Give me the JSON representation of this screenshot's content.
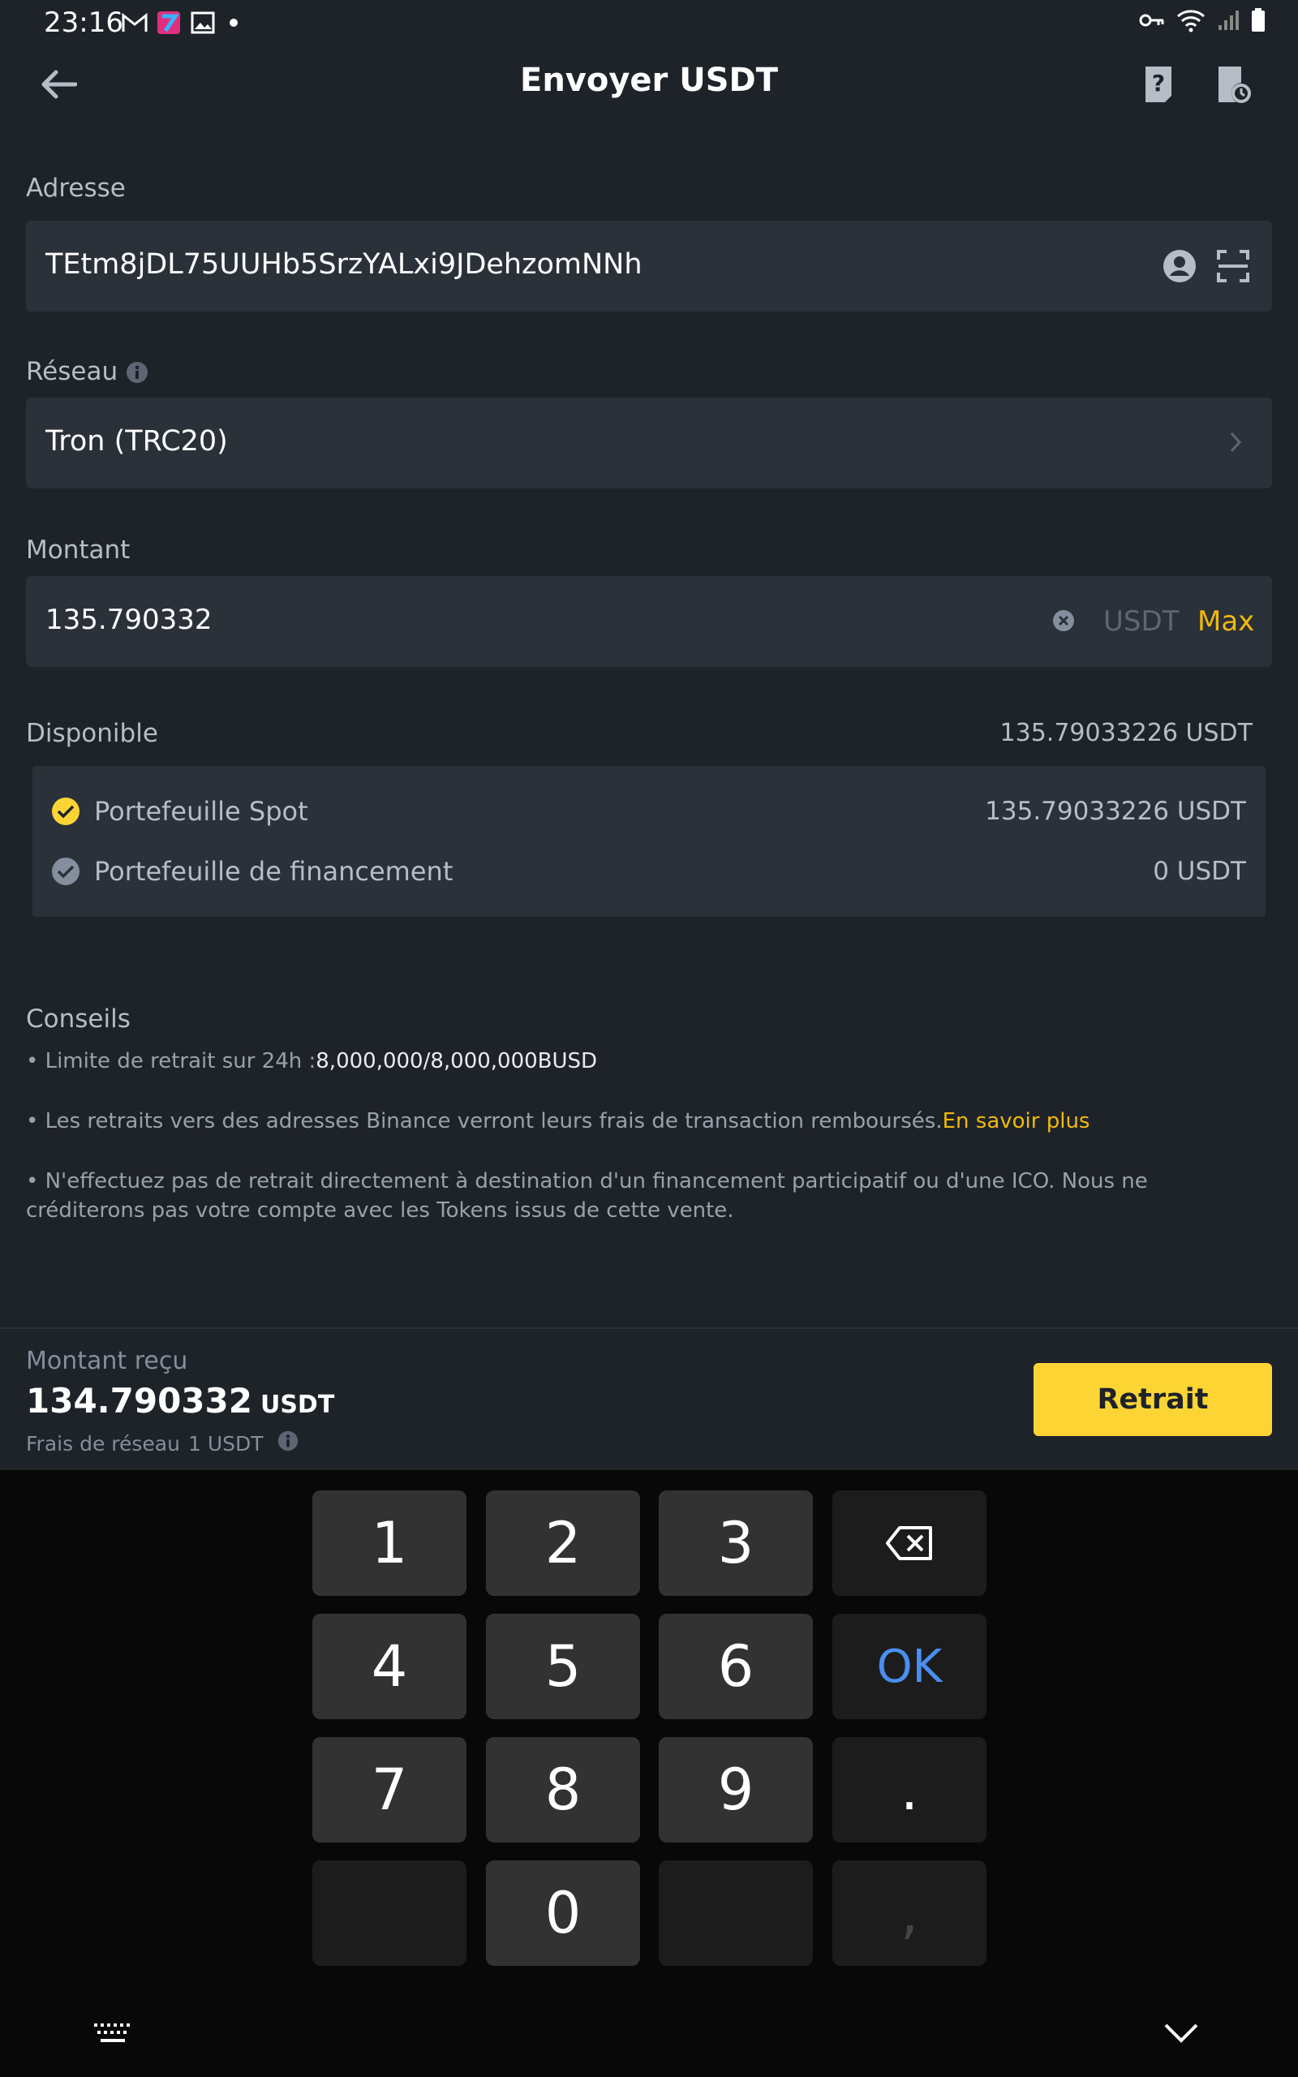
{
  "status_bar": {
    "time": "23:16"
  },
  "header": {
    "title": "Envoyer USDT"
  },
  "address": {
    "label": "Adresse",
    "value": "TEtm8jDL75UUHb5SrzYALxi9JDehzomNNh"
  },
  "network": {
    "label": "Réseau",
    "value": "Tron (TRC20)"
  },
  "amount": {
    "label": "Montant",
    "value": "135.790332",
    "unit": "USDT",
    "max_label": "Max"
  },
  "available": {
    "label": "Disponible",
    "value": "135.79033226 USDT",
    "wallets": [
      {
        "name": "Portefeuille Spot",
        "value": "135.79033226 USDT",
        "selected": true
      },
      {
        "name": "Portefeuille de financement",
        "value": "0 USDT",
        "selected": false
      }
    ]
  },
  "tips": {
    "title": "Conseils",
    "limit_prefix": "• Limite de retrait sur 24h :",
    "limit_value": "8,000,000/8,000,000BUSD",
    "refund_text": "• Les retraits vers des adresses Binance verront leurs frais de transaction remboursés.",
    "refund_link": "En savoir plus",
    "ico_text": "• N'effectuez pas de retrait directement à destination d'un financement participatif ou d'une ICO. Nous ne créditerons pas votre compte avec les Tokens issus de cette vente."
  },
  "summary": {
    "received_label": "Montant reçu",
    "received_value": "134.790332",
    "received_unit": "USDT",
    "fee_label": "Frais de réseau",
    "fee_value": "1 USDT",
    "withdraw_label": "Retrait"
  },
  "keyboard": {
    "keys": [
      "1",
      "2",
      "3",
      "4",
      "5",
      "6",
      "7",
      "8",
      "9",
      ".",
      "0",
      ","
    ],
    "ok_label": "OK"
  },
  "colors": {
    "background": "#1e2329",
    "field": "#2b3139",
    "accent": "#f0b90b",
    "button": "#fcd535",
    "ok_blue": "#4a8ff0"
  }
}
